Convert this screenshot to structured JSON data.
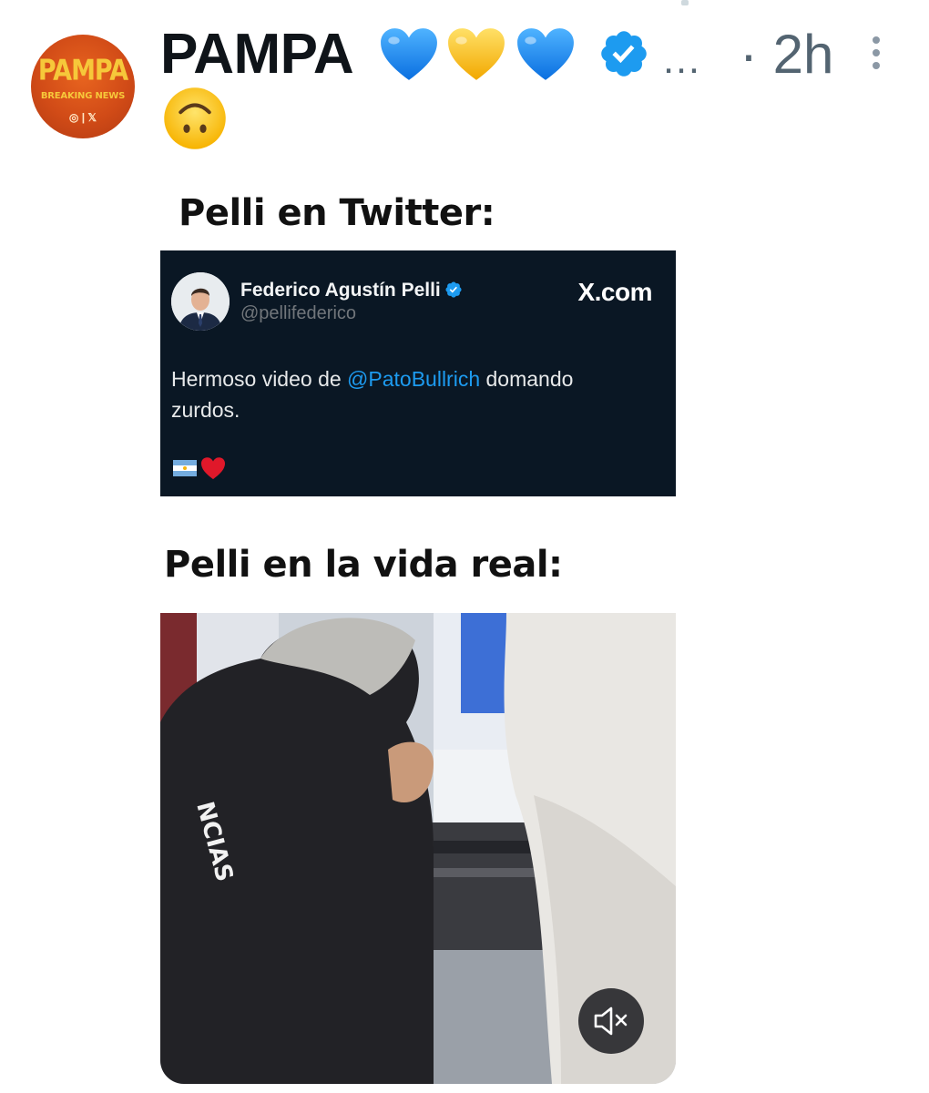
{
  "post": {
    "display_name": "PAMPA",
    "name_emojis": [
      "blue-heart",
      "yellow-heart",
      "blue-heart"
    ],
    "truncation": "…",
    "timestamp": "· 2h",
    "second_line_emoji": "upside-down-face",
    "avatar": {
      "logo_text": "PAMPA",
      "logo_subtitle": "BREAKING NEWS",
      "logo_icons": "◎ | 𝕏"
    }
  },
  "media": {
    "caption_top": "Pelli en Twitter:",
    "caption_bottom": "Pelli en la vida real:",
    "embedded_tweet": {
      "author": "Federico Agustín Pelli",
      "handle": "@pellifederico",
      "site": "X.com",
      "text_before": "Hermoso video de ",
      "mention": "@PatoBullrich",
      "text_after": " domando zurdos.",
      "emoji": [
        "argentina-flag",
        "red-heart"
      ]
    },
    "video": {
      "shirt_text": "NCIAS",
      "muted": true
    }
  },
  "colors": {
    "verified_blue": "#1d9bf0",
    "heart_blue": "#1e90ff",
    "heart_yellow": "#ffc21a",
    "tweet_bg": "#0a1724",
    "avatar_orange": "#d14b17",
    "muted_text": "#536471"
  }
}
